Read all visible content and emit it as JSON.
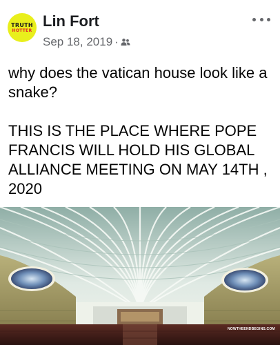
{
  "post": {
    "author": "Lin Fort",
    "avatar": {
      "line1": "TRUTH",
      "line2": "HOTTER"
    },
    "date": "Sep 18, 2019",
    "separator": "·",
    "audience_icon": "friends-icon",
    "more_icon": "more-options-icon",
    "text_line1": "why does the vatican house look like a snake?",
    "text_line2": "THIS IS THE PLACE WHERE POPE FRANCIS WILL HOLD HIS GLOBAL ALLIANCE MEETING ON MAY 14TH , 2020",
    "image": {
      "subject": "Paul VI Audience Hall interior",
      "watermark": "NOWTHEENDBEGINS.COM"
    }
  },
  "colors": {
    "author": "#1c1e21",
    "meta": "#65676b",
    "body_text": "#050505",
    "avatar_bg": "#e9ef1c",
    "avatar_accent": "#e0242a"
  }
}
